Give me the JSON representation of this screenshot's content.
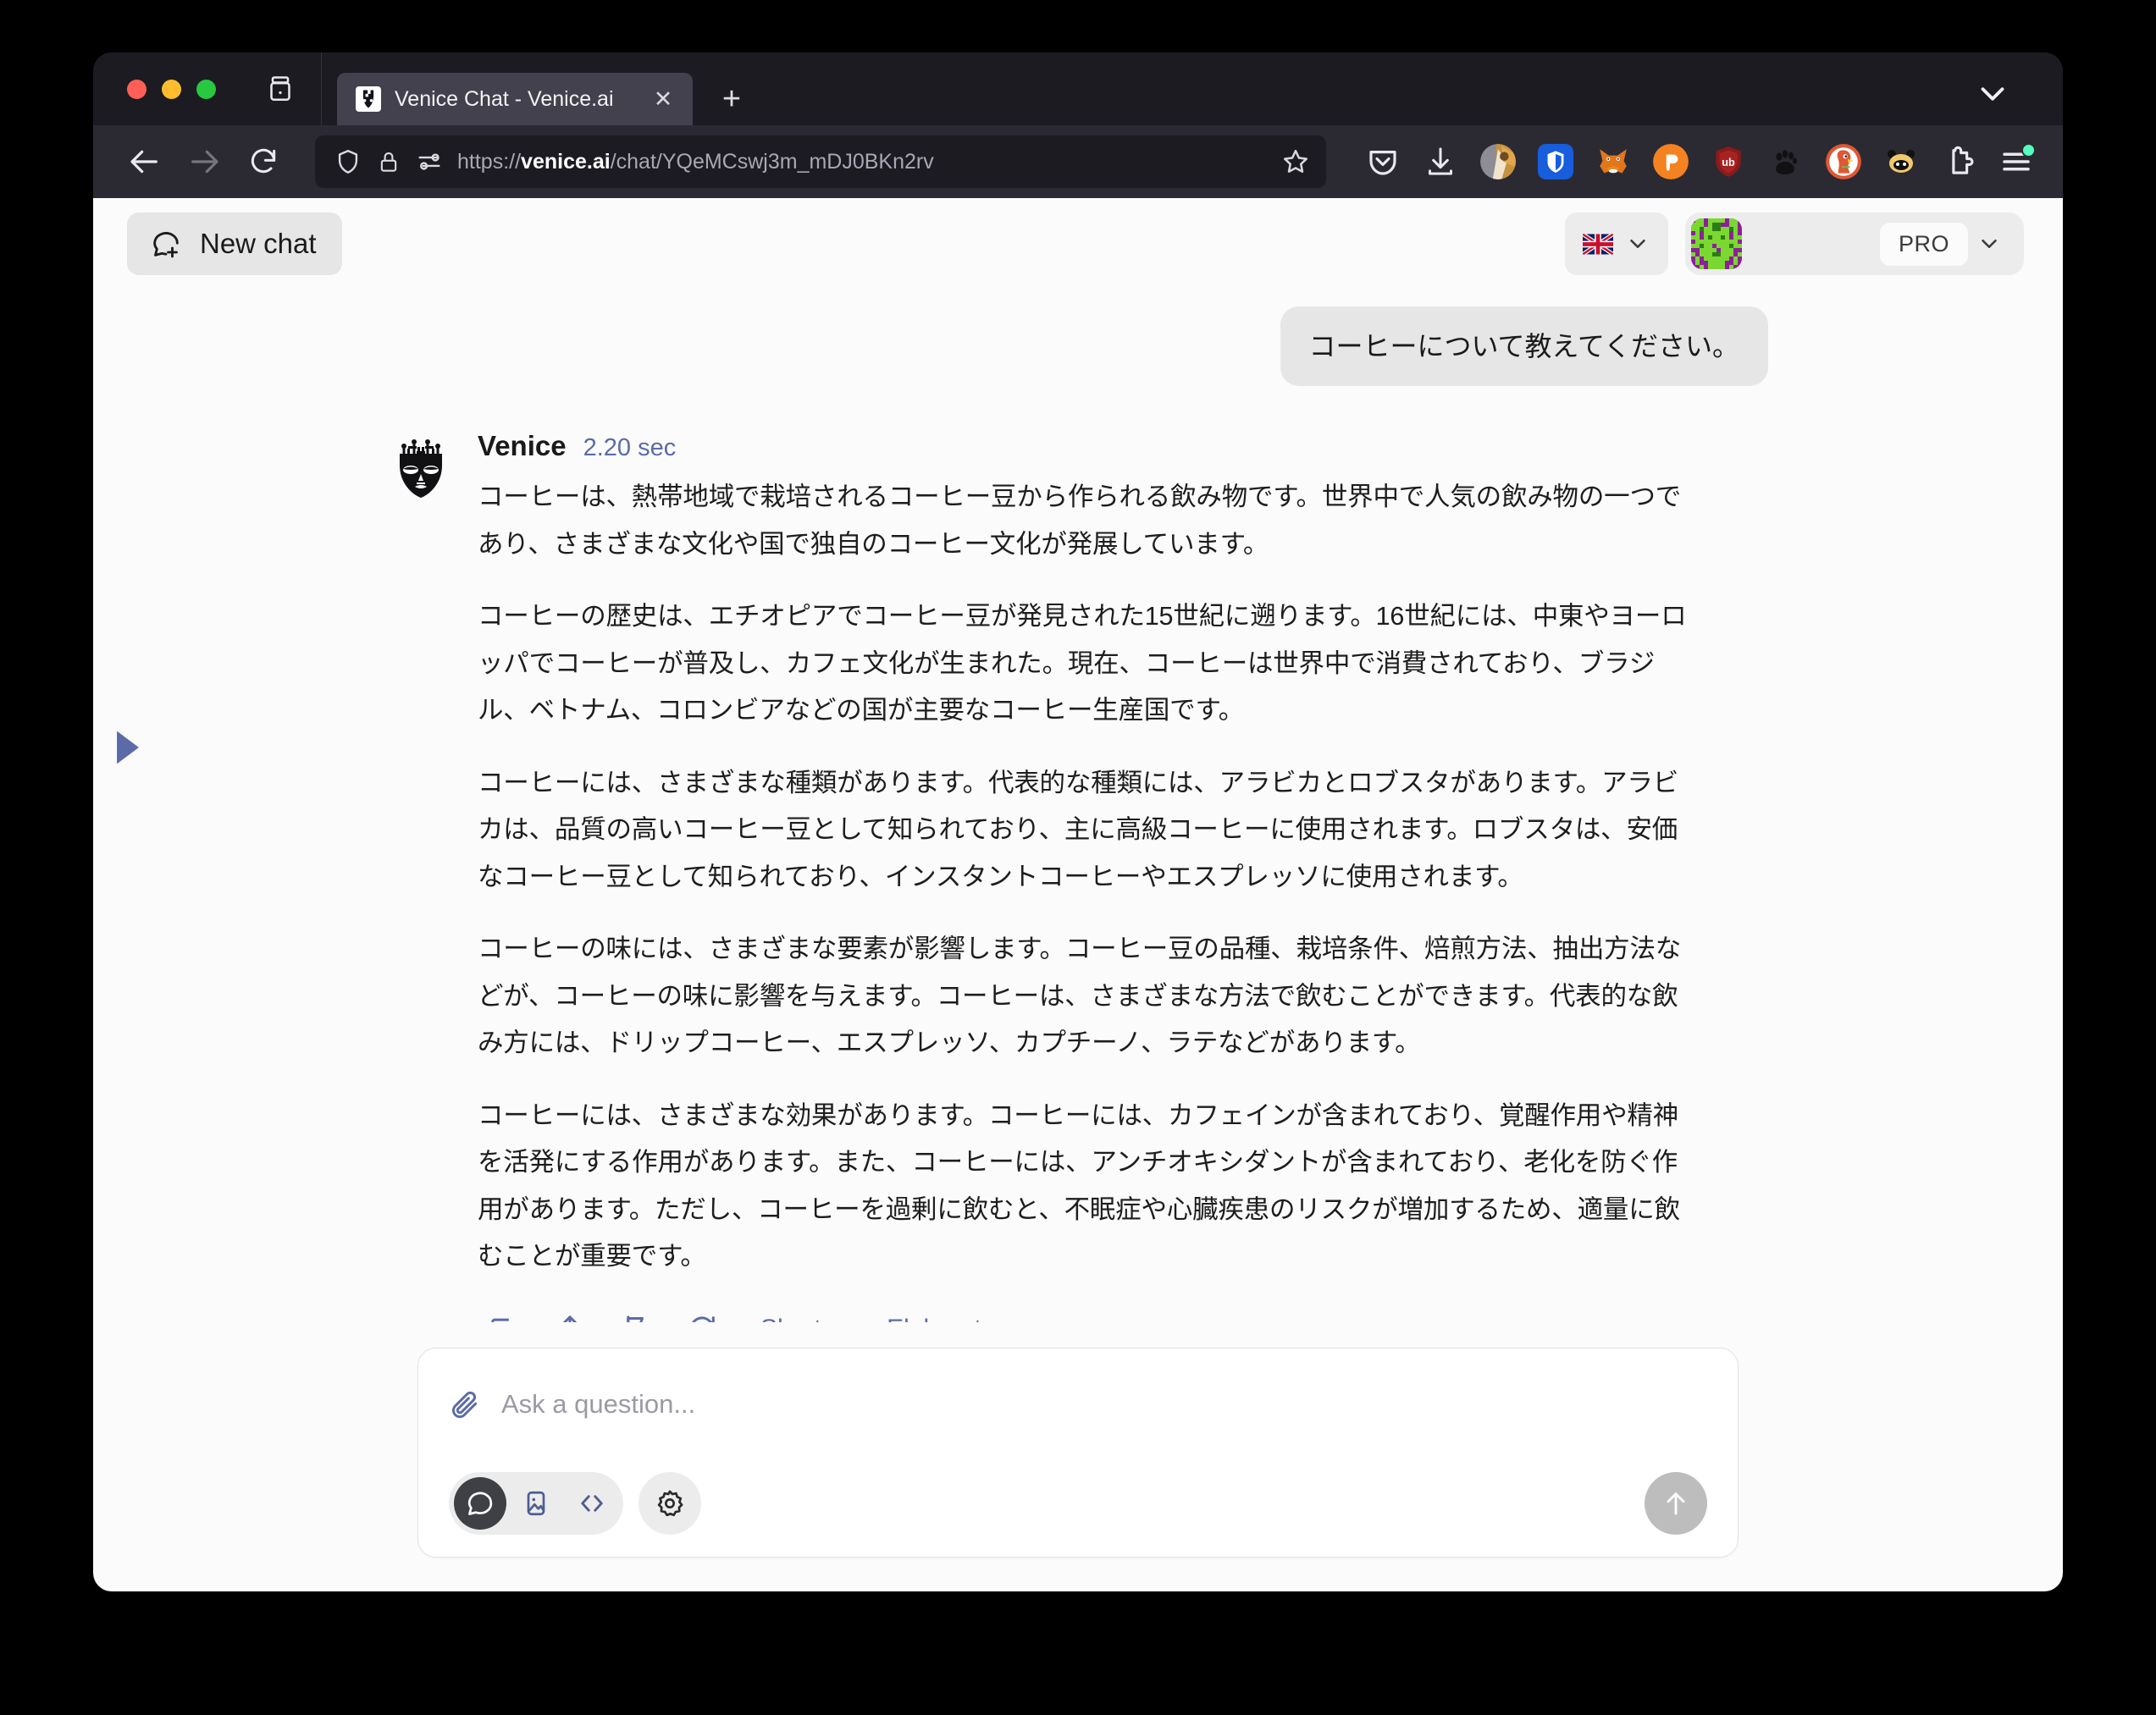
{
  "browser": {
    "tab": {
      "title": "Venice Chat - Venice.ai",
      "favicon_name": "venice-mask-favicon",
      "close_label": "✕"
    },
    "new_tab_label": "+",
    "tab_list_icon": "tab-list-icon",
    "tabstrip_chevron": "chevron-down-icon",
    "nav": {
      "back": "←",
      "forward": "→",
      "reload": "↻"
    },
    "url": {
      "scheme": "https://",
      "domain": "venice.ai",
      "path": "/chat/YQeMCswj3m_mDJ0BKn2rv",
      "full": "https://venice.ai/chat/YQeMCswj3m_mDJ0BKn2rv",
      "shield_icon": "shield-icon",
      "lock_icon": "lock-icon",
      "permissions_icon": "permissions-icon",
      "bookmark_icon": "bookmark-star-icon"
    },
    "extensions": [
      {
        "name": "pocket-icon",
        "label": "Pocket"
      },
      {
        "name": "downloads-icon",
        "label": "Downloads"
      },
      {
        "name": "profile-avatar-icon",
        "label": "Profile"
      },
      {
        "name": "bitwarden-icon",
        "label": "Bitwarden"
      },
      {
        "name": "metamask-icon",
        "label": "MetaMask"
      },
      {
        "name": "phantom-icon",
        "label": "Phantom"
      },
      {
        "name": "ublock-origin-icon",
        "label": "uBlock Origin"
      },
      {
        "name": "gnome-paw-icon",
        "label": "GNOME Shell Integration"
      },
      {
        "name": "duckduckgo-icon",
        "label": "DuckDuckGo Privacy Essentials"
      },
      {
        "name": "keplr-icon",
        "label": "Keplr"
      },
      {
        "name": "extensions-puzzle-icon",
        "label": "Extensions"
      },
      {
        "name": "app-menu-icon",
        "label": "Open application menu"
      }
    ]
  },
  "app": {
    "new_chat": {
      "label": "New chat",
      "icon": "chat-plus-icon"
    },
    "language": {
      "flag": "uk-flag-icon",
      "chevron": "chevron-down-icon"
    },
    "account": {
      "avatar": "identicon-avatar",
      "username": "",
      "plan_badge": "PRO",
      "chevron": "chevron-down-icon"
    },
    "sidebar_handle_icon": "sidebar-expand-triangle-icon"
  },
  "conversation": {
    "user_message": "コーヒーについて教えてください。",
    "assistant": {
      "name": "Venice",
      "logo": "venice-mask-logo",
      "duration": "2.20 sec",
      "paragraphs": [
        "コーヒーは、熱帯地域で栽培されるコーヒー豆から作られる飲み物です。世界中で人気の飲み物の一つであり、さまざまな文化や国で独自のコーヒー文化が発展しています。",
        "コーヒーの歴史は、エチオピアでコーヒー豆が発見された15世紀に遡ります。16世紀には、中東やヨーロッパでコーヒーが普及し、カフェ文化が生まれた。現在、コーヒーは世界中で消費されており、ブラジル、ベトナム、コロンビアなどの国が主要なコーヒー生産国です。",
        "コーヒーには、さまざまな種類があります。代表的な種類には、アラビカとロブスタがあります。アラビカは、品質の高いコーヒー豆として知られており、主に高級コーヒーに使用されます。ロブスタは、安価なコーヒー豆として知られており、インスタントコーヒーやエスプレッソに使用されます。",
        "コーヒーの味には、さまざまな要素が影響します。コーヒー豆の品種、栽培条件、焙煎方法、抽出方法などが、コーヒーの味に影響を与えます。コーヒーは、さまざまな方法で飲むことができます。代表的な飲み方には、ドリップコーヒー、エスプレッソ、カプチーノ、ラテなどがあります。",
        "コーヒーには、さまざまな効果があります。コーヒーには、カフェインが含まれており、覚醒作用や精神を活発にする作用があります。また、コーヒーには、アンチオキシダントが含まれており、老化を防ぐ作用があります。ただし、コーヒーを過剰に飲むと、不眠症や心臓疾患のリスクが増加するため、適量に飲むことが重要です。"
      ],
      "actions": {
        "icons": [
          {
            "name": "copy-icon",
            "label": "Copy"
          },
          {
            "name": "share-icon",
            "label": "Share"
          },
          {
            "name": "flag-icon",
            "label": "Report"
          },
          {
            "name": "regenerate-icon",
            "label": "Regenerate"
          }
        ],
        "shorten_label": "Shorten",
        "elaborate_label": "Elaborate"
      }
    }
  },
  "composer": {
    "placeholder": "Ask a question...",
    "attach_icon": "paperclip-icon",
    "modes": [
      {
        "name": "chat-mode-icon",
        "label": "Chat",
        "active": true
      },
      {
        "name": "image-mode-icon",
        "label": "Image",
        "active": false
      },
      {
        "name": "code-mode-icon",
        "label": "Code",
        "active": false
      }
    ],
    "settings_icon": "gear-icon",
    "send_icon": "send-arrow-icon"
  },
  "colors": {
    "accent_blue": "#5b6ba8",
    "page_bg": "#fbfbfb",
    "bubble_bg": "#e6e6e6",
    "chrome_dark": "#2b2a33",
    "tabstrip": "#1c1b22"
  }
}
